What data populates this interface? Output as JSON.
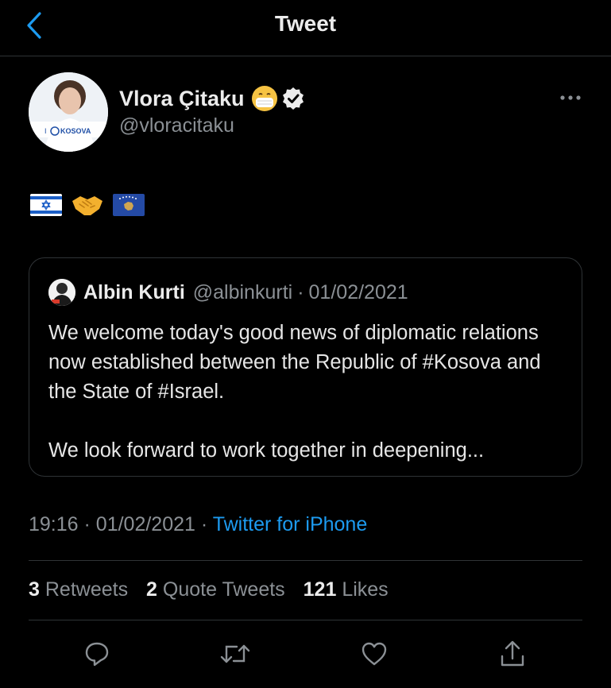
{
  "header": {
    "title": "Tweet"
  },
  "tweet": {
    "author_name": "Vlora Çitaku",
    "author_handle": "@vloracitaku",
    "avatar_badge_text": "KOSOVA",
    "avatar_badge_prefix": "I",
    "emojis": [
      "israel-flag",
      "handshake",
      "kosovo-flag"
    ]
  },
  "quote": {
    "author_name": "Albin Kurti",
    "author_handle": "@albinkurti",
    "separator": "·",
    "date": "01/02/2021",
    "paragraphs": [
      "We welcome today's good news of diplomatic relations now established between the Republic of #Kosova and the State of #Israel.",
      "We look forward to work together in deepening..."
    ]
  },
  "meta": {
    "time": "19:16",
    "separator": "·",
    "date": "01/02/2021",
    "source": "Twitter for iPhone"
  },
  "stats": {
    "retweets_count": "3",
    "retweets_label": "Retweets",
    "quotes_count": "2",
    "quotes_label": "Quote Tweets",
    "likes_count": "121",
    "likes_label": "Likes"
  },
  "colors": {
    "background": "#000000",
    "link": "#1d9bf0",
    "secondary_text": "#8b9095",
    "border": "#2f3336"
  }
}
